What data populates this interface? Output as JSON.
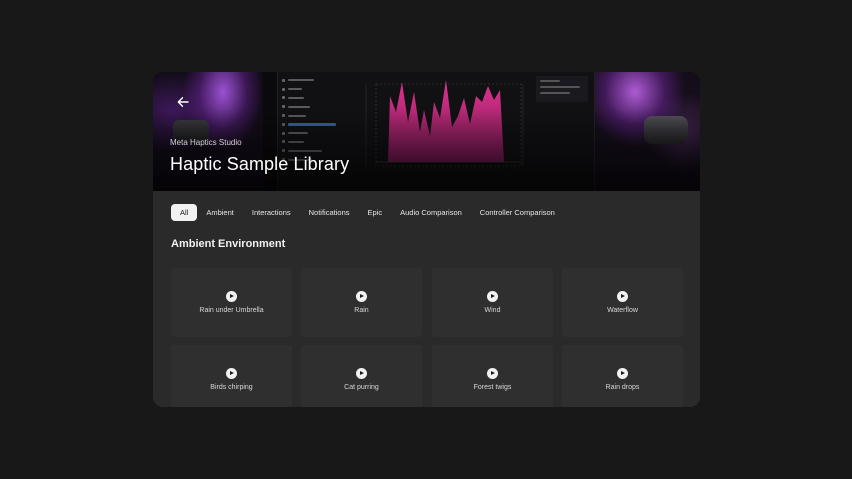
{
  "hero": {
    "subtitle": "Meta Haptics Studio",
    "title": "Haptic Sample Library"
  },
  "tabs": [
    {
      "label": "All",
      "active": true
    },
    {
      "label": "Ambient",
      "active": false
    },
    {
      "label": "Interactions",
      "active": false
    },
    {
      "label": "Notifications",
      "active": false
    },
    {
      "label": "Epic",
      "active": false
    },
    {
      "label": "Audio Comparison",
      "active": false
    },
    {
      "label": "Controller Comparison",
      "active": false
    }
  ],
  "section": {
    "title": "Ambient Environment"
  },
  "samples": [
    {
      "label": "Rain under Umbrella"
    },
    {
      "label": "Rain"
    },
    {
      "label": "Wind"
    },
    {
      "label": "Waterflow"
    },
    {
      "label": "Birds chirping"
    },
    {
      "label": "Cat purring"
    },
    {
      "label": "Forest twigs"
    },
    {
      "label": "Rain drops"
    }
  ],
  "colors": {
    "background": "#181818",
    "window": "#2a2a2b",
    "card": "#2f2f30",
    "waveform": "#e0338f",
    "active_tab": "#f2f2f2"
  },
  "icons": {
    "back": "arrow-left-icon",
    "play": "play-circle-icon"
  }
}
